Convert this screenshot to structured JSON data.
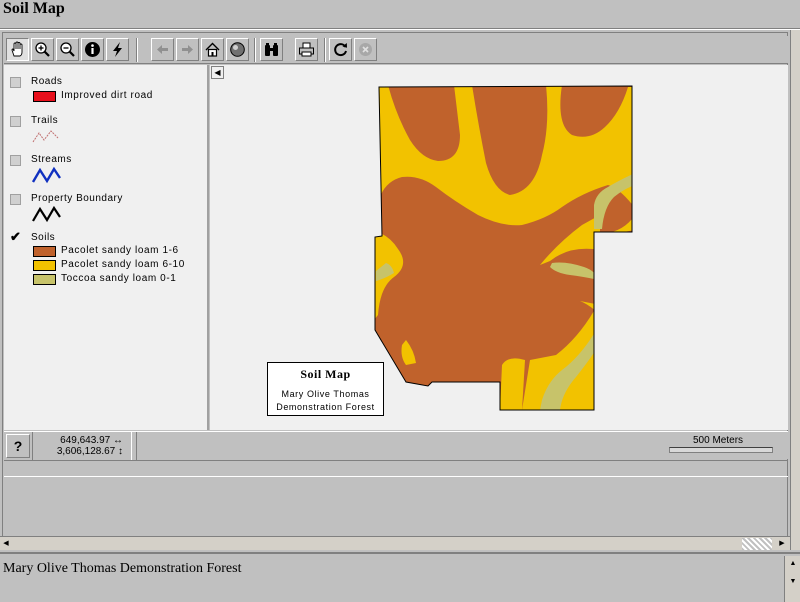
{
  "window": {
    "title": "Soil Map"
  },
  "toolbar": {
    "buttons": [
      {
        "name": "pan-button",
        "icon": "hand-icon",
        "active": true
      },
      {
        "name": "zoom-in-button",
        "icon": "zoom-in-icon"
      },
      {
        "name": "zoom-out-button",
        "icon": "zoom-out-icon"
      },
      {
        "name": "identify-button",
        "icon": "info-icon"
      },
      {
        "name": "hotlink-button",
        "icon": "lightning-icon"
      },
      {
        "name": "back-button",
        "icon": "arrow-left-icon",
        "disabled": true
      },
      {
        "name": "forward-button",
        "icon": "arrow-right-icon",
        "disabled": true
      },
      {
        "name": "full-extent-button",
        "icon": "home-icon"
      },
      {
        "name": "globe-button",
        "icon": "globe-icon"
      },
      {
        "name": "find-button",
        "icon": "binoculars-icon"
      },
      {
        "name": "print-button",
        "icon": "printer-icon"
      },
      {
        "name": "refresh-button",
        "icon": "refresh-icon"
      },
      {
        "name": "stop-button",
        "icon": "stop-icon",
        "disabled": true
      }
    ]
  },
  "legend": {
    "layers": [
      {
        "name": "Roads",
        "checked": false,
        "items": [
          {
            "label": "Improved dirt road",
            "color": "#e8101c"
          }
        ]
      },
      {
        "name": "Trails",
        "checked": false
      },
      {
        "name": "Streams",
        "checked": false
      },
      {
        "name": "Property Boundary",
        "checked": false
      },
      {
        "name": "Soils",
        "checked": true,
        "items": [
          {
            "label": "Pacolet sandy loam 1-6",
            "color": "#c0622c"
          },
          {
            "label": "Pacolet sandy loam 6-10",
            "color": "#f2c200"
          },
          {
            "label": "Toccoa sandy loam 0-1",
            "color": "#c7c36a"
          }
        ]
      }
    ],
    "check_mark": "✔"
  },
  "map": {
    "title": "Soil Map",
    "subtitle_line1": "Mary Olive Thomas",
    "subtitle_line2": "Demonstration Forest",
    "background": "#f0f0f0"
  },
  "status": {
    "help_label": "?",
    "x_coord": "649,643.97",
    "y_coord": "3,606,128.67",
    "scale_label": "500 Meters"
  },
  "footer": {
    "text": "Mary Olive Thomas Demonstration Forest"
  }
}
